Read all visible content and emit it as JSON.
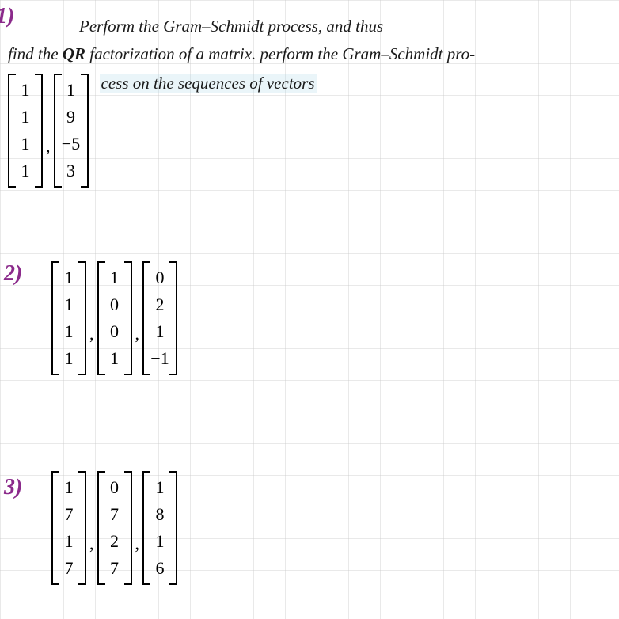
{
  "instruction": {
    "line1": "Perform the Gram–Schmidt process, and thus",
    "line2a": "find the ",
    "line2_qr": "QR",
    "line2b": " factorization of a matrix. perform the Gram–Schmidt pro-",
    "inline": "cess on the sequences of vectors"
  },
  "problems": {
    "p1": {
      "number": "1)",
      "vectors": [
        [
          "1",
          "1",
          "1",
          "1"
        ],
        [
          "1",
          "9",
          "−5",
          "3"
        ]
      ]
    },
    "p2": {
      "number": "2)",
      "vectors": [
        [
          "1",
          "1",
          "1",
          "1"
        ],
        [
          "1",
          "0",
          "0",
          "1"
        ],
        [
          "0",
          "2",
          "1",
          "−1"
        ]
      ]
    },
    "p3": {
      "number": "3)",
      "vectors": [
        [
          "1",
          "7",
          "1",
          "7"
        ],
        [
          "0",
          "7",
          "2",
          "7"
        ],
        [
          "1",
          "8",
          "1",
          "6"
        ]
      ]
    }
  }
}
